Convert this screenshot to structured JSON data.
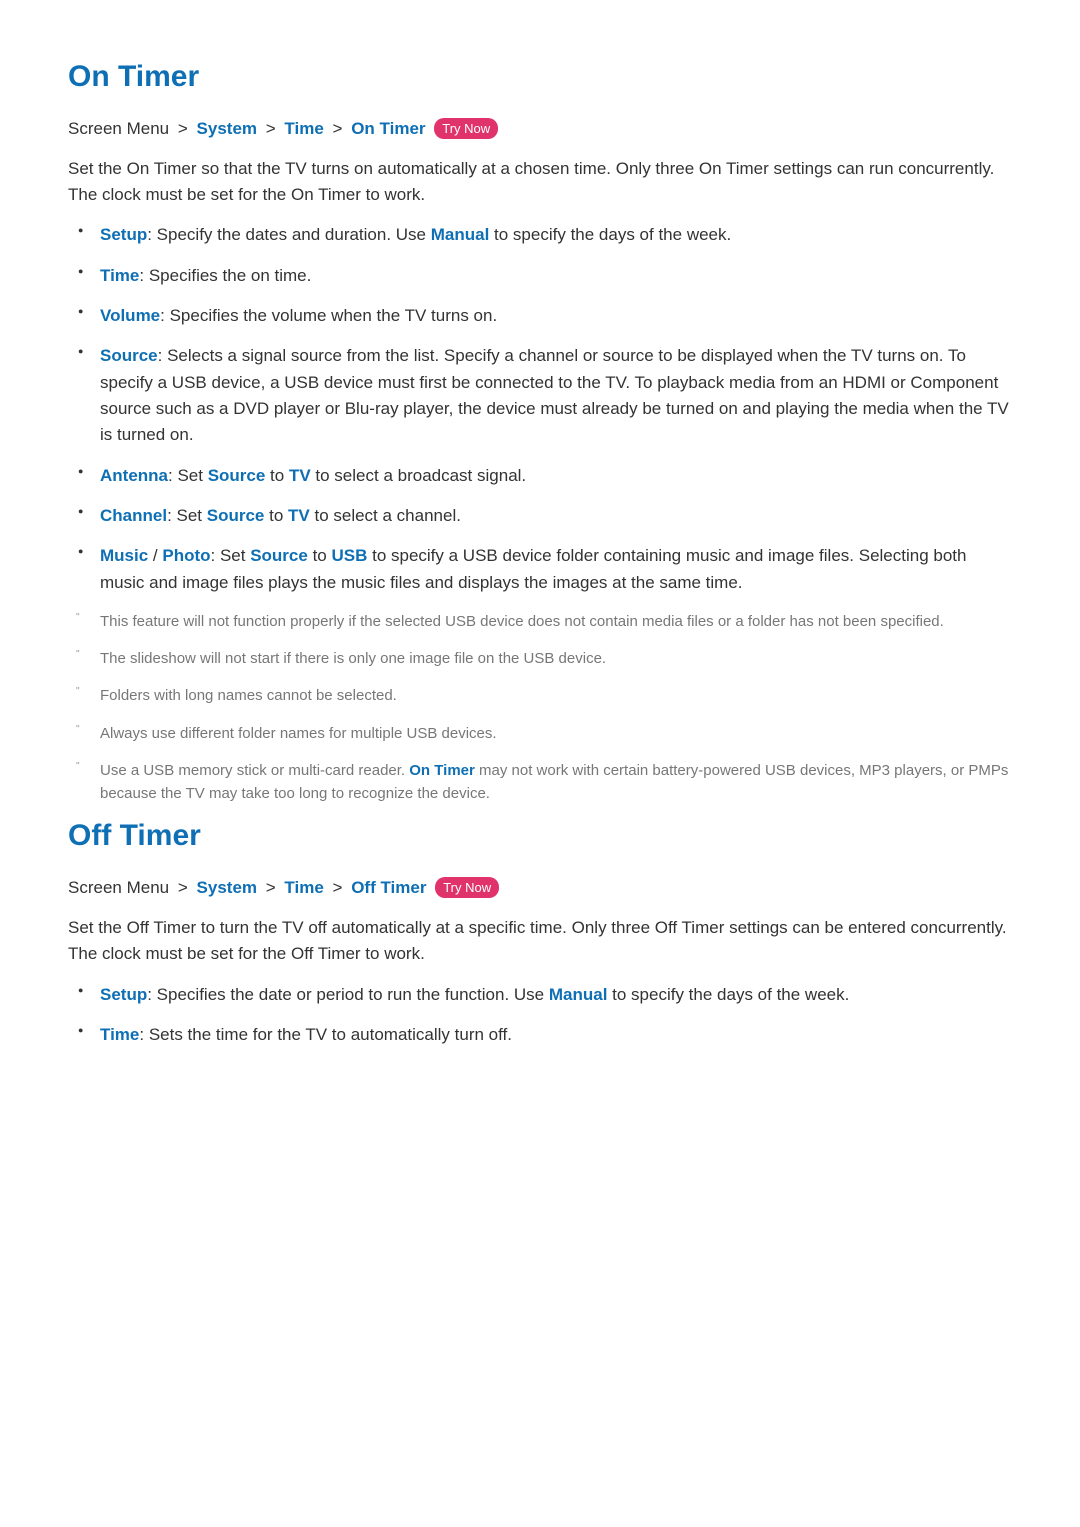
{
  "onTimer": {
    "title": "On Timer",
    "breadcrumb": {
      "label": "Screen Menu",
      "sep": ">",
      "p1": "System",
      "p2": "Time",
      "p3": "On Timer",
      "tryNow": "Try Now"
    },
    "intro": "Set the On Timer so that the TV turns on automatically at a chosen time. Only three On Timer settings can run concurrently. The clock must be set for the On Timer to work.",
    "items": {
      "setup": {
        "term": "Setup",
        "pre": ": Specify the dates and duration. Use ",
        "manual": "Manual",
        "post": " to specify the days of the week."
      },
      "time": {
        "term": "Time",
        "text": ": Specifies the on time."
      },
      "volume": {
        "term": "Volume",
        "text": ": Specifies the volume when the TV turns on."
      },
      "source": {
        "term": "Source",
        "text": ": Selects a signal source from the list. Specify a channel or source to be displayed when the TV turns on. To specify a USB device, a USB device must first be connected to the TV. To playback media from an HDMI or Component source such as a DVD player or Blu-ray player, the device must already be turned on and playing the media when the TV is turned on."
      },
      "antenna": {
        "term": "Antenna",
        "pre": ": Set ",
        "src": "Source",
        "mid": " to ",
        "tv": "TV",
        "post": " to select a broadcast signal."
      },
      "channel": {
        "term": "Channel",
        "pre": ": Set ",
        "src": "Source",
        "mid": " to ",
        "tv": "TV",
        "post": " to select a channel."
      },
      "music": {
        "term": "Music",
        "slash": " / ",
        "term2": "Photo",
        "pre": ": Set ",
        "src": "Source",
        "mid": " to ",
        "usb": "USB",
        "post": " to specify a USB device folder containing music and image files. Selecting both music and image files plays the music files and displays the images at the same time."
      }
    },
    "notes": {
      "n1": "This feature will not function properly if the selected USB device does not contain media files or a folder has not been specified.",
      "n2": "The slideshow will not start if there is only one image file on the USB device.",
      "n3": "Folders with long names cannot be selected.",
      "n4": "Always use different folder names for multiple USB devices.",
      "n5": {
        "pre": "Use a USB memory stick or multi-card reader. ",
        "strong": "On Timer",
        "post": " may not work with certain battery-powered USB devices, MP3 players, or PMPs because the TV may take too long to recognize the device."
      }
    }
  },
  "offTimer": {
    "title": "Off Timer",
    "breadcrumb": {
      "label": "Screen Menu",
      "sep": ">",
      "p1": "System",
      "p2": "Time",
      "p3": "Off Timer",
      "tryNow": "Try Now"
    },
    "intro": "Set the Off Timer to turn the TV off automatically at a specific time. Only three Off Timer settings can be entered concurrently. The clock must be set for the Off Timer to work.",
    "items": {
      "setup": {
        "term": "Setup",
        "pre": ": Specifies the date or period to run the function. Use ",
        "manual": "Manual",
        "post": " to specify the days of the week."
      },
      "time": {
        "term": "Time",
        "text": ": Sets the time for the TV to automatically turn off."
      }
    }
  }
}
